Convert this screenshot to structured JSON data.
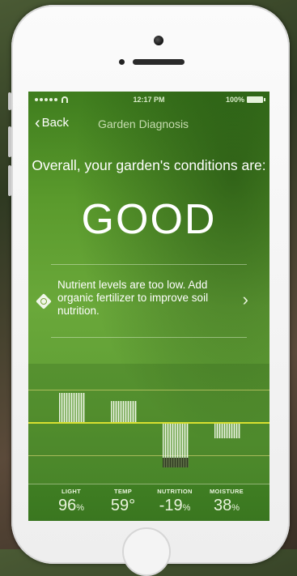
{
  "status_bar": {
    "time": "12:17 PM",
    "battery": "100%"
  },
  "nav": {
    "back_label": "Back",
    "title": "Garden Diagnosis"
  },
  "summary": {
    "headline": "Overall, your garden's conditions are:",
    "verdict": "GOOD"
  },
  "alert": {
    "text": "Nutrient levels are too low. Add organic fertilizer to improve soil nutrition."
  },
  "metrics": [
    {
      "label": "LIGHT",
      "value": "96",
      "unit": "%"
    },
    {
      "label": "TEMP",
      "value": "59°",
      "unit": ""
    },
    {
      "label": "NUTRITION",
      "value": "-19",
      "unit": "%"
    },
    {
      "label": "MOISTURE",
      "value": "38",
      "unit": "%"
    }
  ],
  "colors": {
    "accent": "#d8e030",
    "background": "#5a9a2c",
    "text": "#ffffff"
  },
  "icons": {
    "back": "chevron-left-icon",
    "alert": "fertilizer-diamond-icon",
    "row_action": "chevron-right-icon"
  }
}
